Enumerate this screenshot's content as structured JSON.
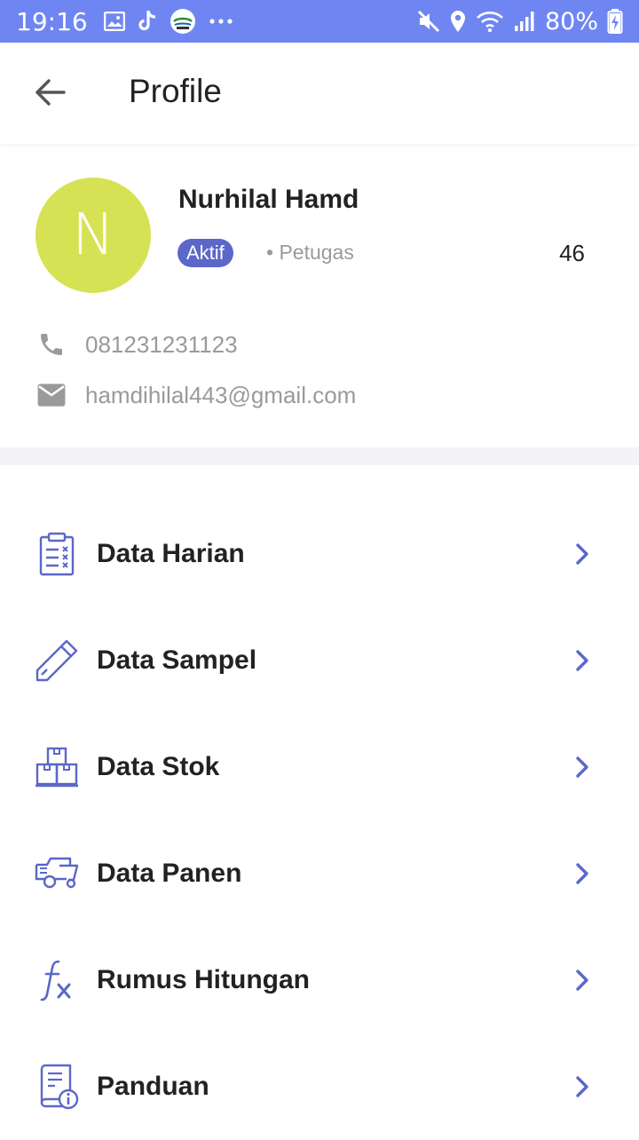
{
  "status_bar": {
    "time": "19:16",
    "battery": "80%",
    "icons_left": [
      "image-icon",
      "tiktok-icon",
      "app-logo-icon",
      "more-dots-icon"
    ],
    "icons_right": [
      "mute-icon",
      "location-icon",
      "wifi-icon",
      "signal-icon",
      "battery-charging-icon"
    ]
  },
  "header": {
    "title": "Profile"
  },
  "profile": {
    "avatar_letter": "N",
    "name": "Nurhilal Hamd",
    "status": "Aktif",
    "role": "• Petugas",
    "count": "46",
    "phone": "081231231123",
    "email": "hamdihilal443@gmail.com"
  },
  "menu": {
    "items": [
      {
        "label": "Data Harian",
        "icon": "clipboard-checklist-icon"
      },
      {
        "label": "Data Sampel",
        "icon": "pencil-icon"
      },
      {
        "label": "Data Stok",
        "icon": "boxes-icon"
      },
      {
        "label": "Data Panen",
        "icon": "harvester-icon"
      },
      {
        "label": "Rumus Hitungan",
        "icon": "formula-fx-icon"
      },
      {
        "label": "Panduan",
        "icon": "guide-book-icon"
      }
    ]
  },
  "colors": {
    "status_bar": "#6f86f2",
    "accent": "#5b67c9",
    "avatar": "#d6e254",
    "text": "#222222",
    "muted": "#9a9a9a"
  }
}
